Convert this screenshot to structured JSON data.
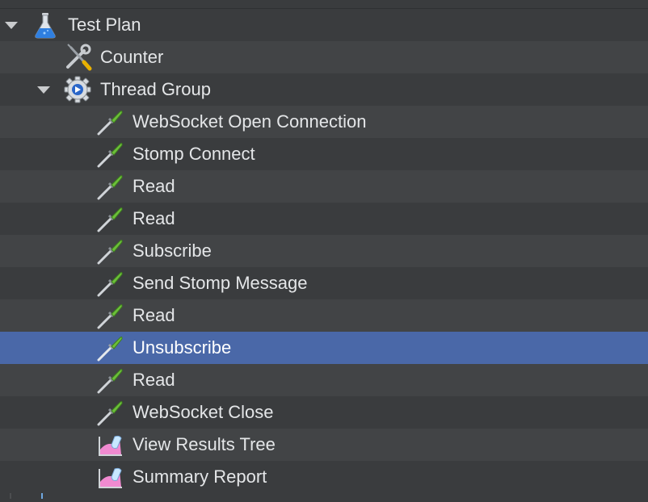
{
  "tree": {
    "items": [
      {
        "label": "Test Plan",
        "icon": "flask-icon",
        "depth": 0,
        "expanded": true,
        "selected": false
      },
      {
        "label": "Counter",
        "icon": "wrench-screwdriver-icon",
        "depth": 1,
        "selected": false
      },
      {
        "label": "Thread Group",
        "icon": "gear-icon",
        "depth": 1,
        "expanded": true,
        "selected": false
      },
      {
        "label": "WebSocket Open Connection",
        "icon": "pipette-icon",
        "depth": 2,
        "selected": false
      },
      {
        "label": "Stomp Connect",
        "icon": "pipette-icon",
        "depth": 2,
        "selected": false
      },
      {
        "label": "Read",
        "icon": "pipette-icon",
        "depth": 2,
        "selected": false
      },
      {
        "label": "Read",
        "icon": "pipette-icon",
        "depth": 2,
        "selected": false
      },
      {
        "label": "Subscribe",
        "icon": "pipette-icon",
        "depth": 2,
        "selected": false
      },
      {
        "label": "Send Stomp Message",
        "icon": "pipette-icon",
        "depth": 2,
        "selected": false
      },
      {
        "label": "Read",
        "icon": "pipette-icon",
        "depth": 2,
        "selected": false
      },
      {
        "label": "Unsubscribe",
        "icon": "pipette-icon",
        "depth": 2,
        "selected": true
      },
      {
        "label": "Read",
        "icon": "pipette-icon",
        "depth": 2,
        "selected": false
      },
      {
        "label": "WebSocket Close",
        "icon": "pipette-icon",
        "depth": 2,
        "selected": false
      },
      {
        "label": "View Results Tree",
        "icon": "chart-listener-icon",
        "depth": 2,
        "selected": false
      },
      {
        "label": "Summary Report",
        "icon": "chart-listener-icon",
        "depth": 2,
        "selected": false
      }
    ]
  },
  "colors": {
    "background": "#3a3c3e",
    "row_alt": "#424446",
    "selection": "#4a68a8",
    "guide_line": "#6fa8e0"
  }
}
